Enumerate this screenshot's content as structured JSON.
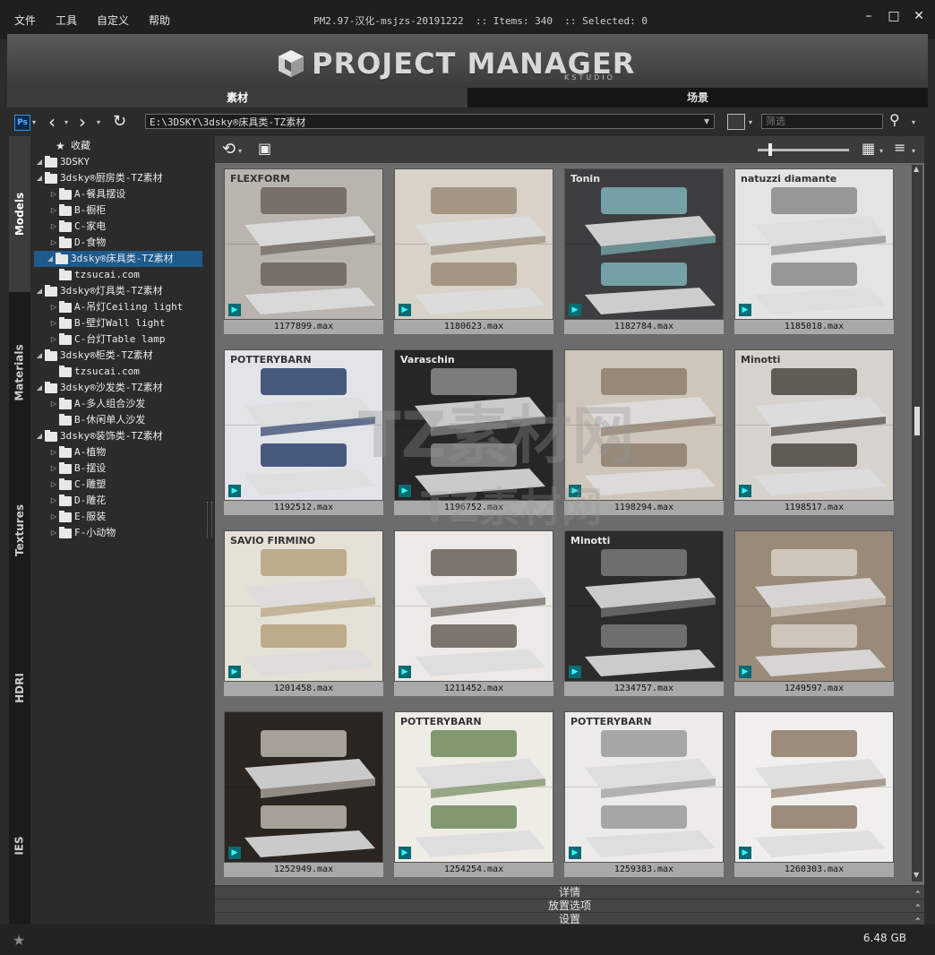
{
  "menu": [
    "文件",
    "工具",
    "自定义",
    "帮助"
  ],
  "window_title": "PM2.97-汉化-msjzs-20191222  :: Items: 340  :: Selected: 0",
  "window_controls": [
    "–",
    "□",
    "✕"
  ],
  "logo": {
    "text": "PROJECT MANAGER",
    "sub": "KSTUDIO"
  },
  "tabs": [
    {
      "label": "素材",
      "active": true
    },
    {
      "label": "场景",
      "active": false
    }
  ],
  "toolbar": {
    "ps_label": "Ps",
    "path": "E:\\3DSKY\\3dsky®床具类-TZ素材",
    "filter_placeholder": "筛选"
  },
  "side_tabs": [
    {
      "label": "Models",
      "active": true
    },
    {
      "label": "Materials",
      "active": false
    },
    {
      "label": "Textures",
      "active": false
    },
    {
      "label": "HDRI",
      "active": false
    },
    {
      "label": "IES",
      "active": false
    }
  ],
  "tree": [
    {
      "label": "收藏",
      "arrow": "",
      "icon": "star",
      "indent": 0
    },
    {
      "label": "3DSKY",
      "arrow": "◢",
      "icon": "folder",
      "indent": 0
    },
    {
      "label": "3dsky®厨房类-TZ素材",
      "arrow": "◢",
      "icon": "folder",
      "indent": 1
    },
    {
      "label": "A-餐具摆设",
      "arrow": "▷",
      "icon": "folder",
      "indent": 2
    },
    {
      "label": "B-橱柜",
      "arrow": "▷",
      "icon": "folder",
      "indent": 2
    },
    {
      "label": "C-家电",
      "arrow": "▷",
      "icon": "folder",
      "indent": 2
    },
    {
      "label": "D-食物",
      "arrow": "▷",
      "icon": "folder",
      "indent": 2
    },
    {
      "label": "3dsky®床具类-TZ素材",
      "arrow": "◢",
      "icon": "folder",
      "indent": 1,
      "selected": true
    },
    {
      "label": "tzsucai.com",
      "arrow": "",
      "icon": "folder",
      "indent": 2
    },
    {
      "label": "3dsky®灯具类-TZ素材",
      "arrow": "◢",
      "icon": "folder",
      "indent": 1
    },
    {
      "label": "A-吊灯Ceiling light",
      "arrow": "▷",
      "icon": "folder",
      "indent": 2
    },
    {
      "label": "B-壁灯Wall light",
      "arrow": "▷",
      "icon": "folder",
      "indent": 2
    },
    {
      "label": "C-台灯Table lamp",
      "arrow": "▷",
      "icon": "folder",
      "indent": 2
    },
    {
      "label": "3dsky®柜类-TZ素材",
      "arrow": "◢",
      "icon": "folder",
      "indent": 1
    },
    {
      "label": "tzsucai.com",
      "arrow": "",
      "icon": "folder",
      "indent": 2
    },
    {
      "label": "3dsky®沙发类-TZ素材",
      "arrow": "◢",
      "icon": "folder",
      "indent": 1
    },
    {
      "label": "A-多人组合沙发",
      "arrow": "▷",
      "icon": "folder",
      "indent": 2
    },
    {
      "label": "B-休闲单人沙发",
      "arrow": "",
      "icon": "folder",
      "indent": 2
    },
    {
      "label": "3dsky®装饰类-TZ素材",
      "arrow": "◢",
      "icon": "folder",
      "indent": 1
    },
    {
      "label": "A-植物",
      "arrow": "▷",
      "icon": "folder",
      "indent": 2
    },
    {
      "label": "B-摆设",
      "arrow": "▷",
      "icon": "folder",
      "indent": 2
    },
    {
      "label": "C-雕塑",
      "arrow": "▷",
      "icon": "folder",
      "indent": 2
    },
    {
      "label": "D-雕花",
      "arrow": "▷",
      "icon": "folder",
      "indent": 2
    },
    {
      "label": "E-服装",
      "arrow": "▷",
      "icon": "folder",
      "indent": 2
    },
    {
      "label": "F-小动物",
      "arrow": "▷",
      "icon": "folder",
      "indent": 2
    }
  ],
  "items": [
    {
      "name": "1177899.max",
      "tone": "#b9b4ad",
      "accent": "#6b635c",
      "overlay": "FLEXFORM"
    },
    {
      "name": "1180623.max",
      "tone": "#d8d2c8",
      "accent": "#9a8c78",
      "overlay": ""
    },
    {
      "name": "1182784.max",
      "tone": "#3e3e40",
      "accent": "#7fb3b8",
      "overlay": "Tonin"
    },
    {
      "name": "1185018.max",
      "tone": "#e4e4e4",
      "accent": "#8a8a8a",
      "overlay": "natuzzi diamante"
    },
    {
      "name": "1192512.max",
      "tone": "#e2e4e8",
      "accent": "#2c3f6a",
      "overlay": "POTTERYBARN"
    },
    {
      "name": "1196752.max",
      "tone": "#262626",
      "accent": "#8c8c8c",
      "overlay": "Varaschin"
    },
    {
      "name": "1198294.max",
      "tone": "#cfc6ba",
      "accent": "#8d7e6c",
      "overlay": ""
    },
    {
      "name": "1198517.max",
      "tone": "#d6d3cf",
      "accent": "#4b4540",
      "overlay": "Minotti"
    },
    {
      "name": "1201458.max",
      "tone": "#e6e1d6",
      "accent": "#b4a27c",
      "overlay": "SAVIO FIRMINO"
    },
    {
      "name": "1211452.max",
      "tone": "#ece9e6",
      "accent": "#6a5f58",
      "overlay": ""
    },
    {
      "name": "1234757.max",
      "tone": "#2c2c2c",
      "accent": "#7a7a7a",
      "overlay": "Minotti"
    },
    {
      "name": "1249597.max",
      "tone": "#9a8a7a",
      "accent": "#d8d0c6",
      "overlay": ""
    },
    {
      "name": "1252949.max",
      "tone": "#2a2520",
      "accent": "#bdb6ae",
      "overlay": ""
    },
    {
      "name": "1254254.max",
      "tone": "#efece6",
      "accent": "#6f8a5a",
      "overlay": "POTTERYBARN"
    },
    {
      "name": "1259383.max",
      "tone": "#ecebea",
      "accent": "#9a9a9a",
      "overlay": "POTTERYBARN"
    },
    {
      "name": "1260303.max",
      "tone": "#f0efee",
      "accent": "#8c7a66",
      "overlay": ""
    }
  ],
  "bottom_panels": [
    "详情",
    "放置选项",
    "设置"
  ],
  "disk_size": "6.48 GB",
  "watermark": [
    "TZ素材网",
    "TZ素材网"
  ]
}
